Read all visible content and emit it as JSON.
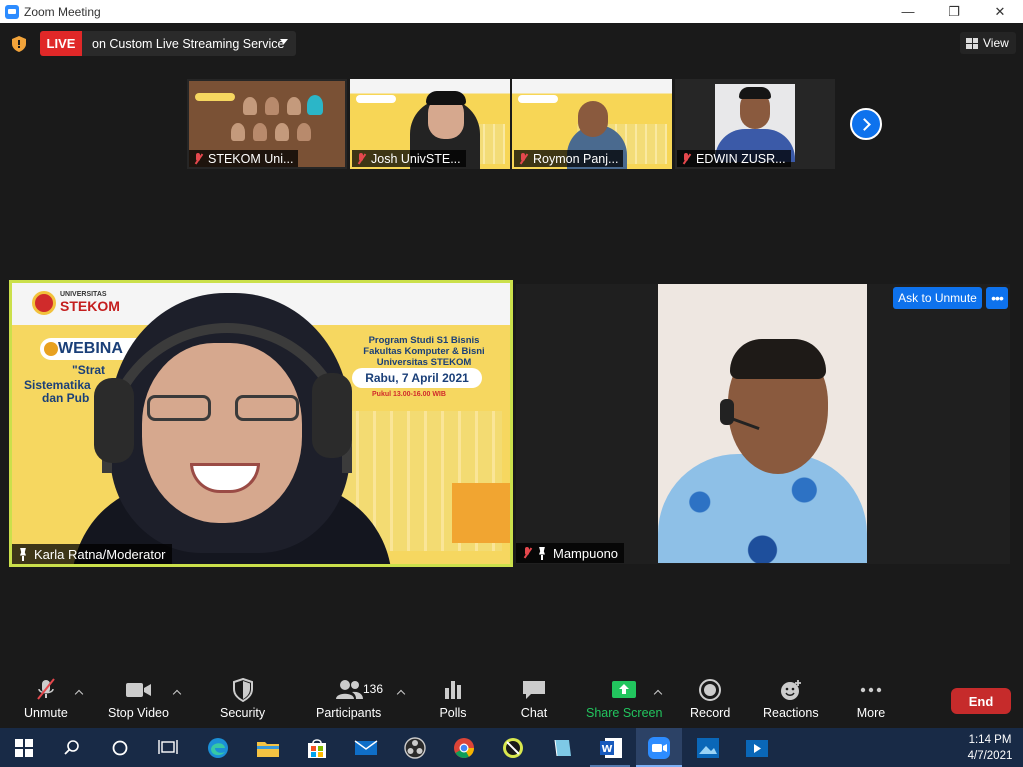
{
  "window": {
    "title": "Zoom Meeting",
    "minimize": "—",
    "maximize": "❐",
    "close": "✕"
  },
  "topbar": {
    "live_label": "LIVE",
    "live_service": "on Custom Live Streaming Service",
    "view_label": "View"
  },
  "thumbnails": [
    {
      "name": "STEKOM Uni..."
    },
    {
      "name": "Josh UnivSTE..."
    },
    {
      "name": "Roymon Panj..."
    },
    {
      "name": "EDWIN ZUSR..."
    }
  ],
  "main_tile": {
    "name": "Karla Ratna/Moderator",
    "slide": {
      "logo_small": "UNIVERSITAS",
      "logo_big": "STEKOM",
      "webinar": "WEBINA",
      "line1": "\"Strat",
      "line2": "Sistematika",
      "line3": "dan Pub",
      "program": "Program Studi S1 Bisnis Fakultas Komputer & Bisni Universitas STEKOM",
      "date": "Rabu, 7 April 2021",
      "time": "Pukul 13.00-16.00 WIB"
    }
  },
  "second_tile": {
    "name": "Mampuono",
    "ask_to_unmute": "Ask to Unmute",
    "more": "•••"
  },
  "toolbar": {
    "unmute": "Unmute",
    "stop_video": "Stop Video",
    "security": "Security",
    "participants": "Participants",
    "participants_count": "136",
    "polls": "Polls",
    "chat": "Chat",
    "share_screen": "Share Screen",
    "record": "Record",
    "reactions": "Reactions",
    "more": "More",
    "end": "End"
  },
  "taskbar": {
    "time": "1:14 PM",
    "date": "4/7/2021"
  },
  "colors": {
    "accent_blue": "#0e72ed",
    "live_red": "#e02828",
    "end_red": "#c62b2b",
    "share_green": "#22c55e",
    "active_speaker_border": "#cbe04b"
  }
}
